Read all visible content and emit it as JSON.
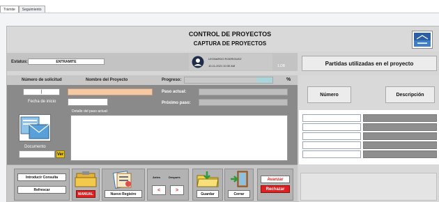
{
  "tabs": [
    "Trámite",
    "Seguimiento"
  ],
  "header": {
    "title": "CONTROL DE PROYECTOS",
    "subtitle": "CAPTURA DE PROYECTOS"
  },
  "status": {
    "label": "Estatus:",
    "value": "ENTRAMITE"
  },
  "user": {
    "name": "LEONARDO RODRIGUEZ",
    "datetime": "10-11-2021 10:30 AM",
    "version": "1.DB"
  },
  "columns": {
    "solicitud": "Número de solicitud",
    "proyecto": "Nombre del Proyecto",
    "progreso": "Progreso:",
    "percent": "%"
  },
  "form": {
    "solicitud_value": "|",
    "fecha_label": "Fecha de inicio",
    "paso_actual_label": "Paso actual:",
    "proximo_paso_label": "Próximo paso:",
    "detalle_label": "Detalle del paso actual:",
    "documento_label": "Documento",
    "ver_button": "Ver"
  },
  "right_panel": {
    "title": "Partidas utilizadas en el proyecto",
    "numero_button": "Número",
    "descripcion_button": "Descripción"
  },
  "toolbar": {
    "introducir_consulta": "Introducir Consulta",
    "refrescar": "Refrescar",
    "manual": "MANUAL",
    "nuevo_registro": "Nuevo Registro",
    "antes": "Antes",
    "despues": "Después",
    "prev": "<",
    "next": ">",
    "guardar": "Guardar",
    "cerrar": "Cerrar",
    "avanzar": "Avanzar",
    "rechazar": "Rechazar"
  },
  "colors": {
    "accent_red": "#e02020",
    "progress_fill": "#a9d6dc",
    "project_field": "#f4c9a4",
    "ver_button": "#e5c21a"
  }
}
